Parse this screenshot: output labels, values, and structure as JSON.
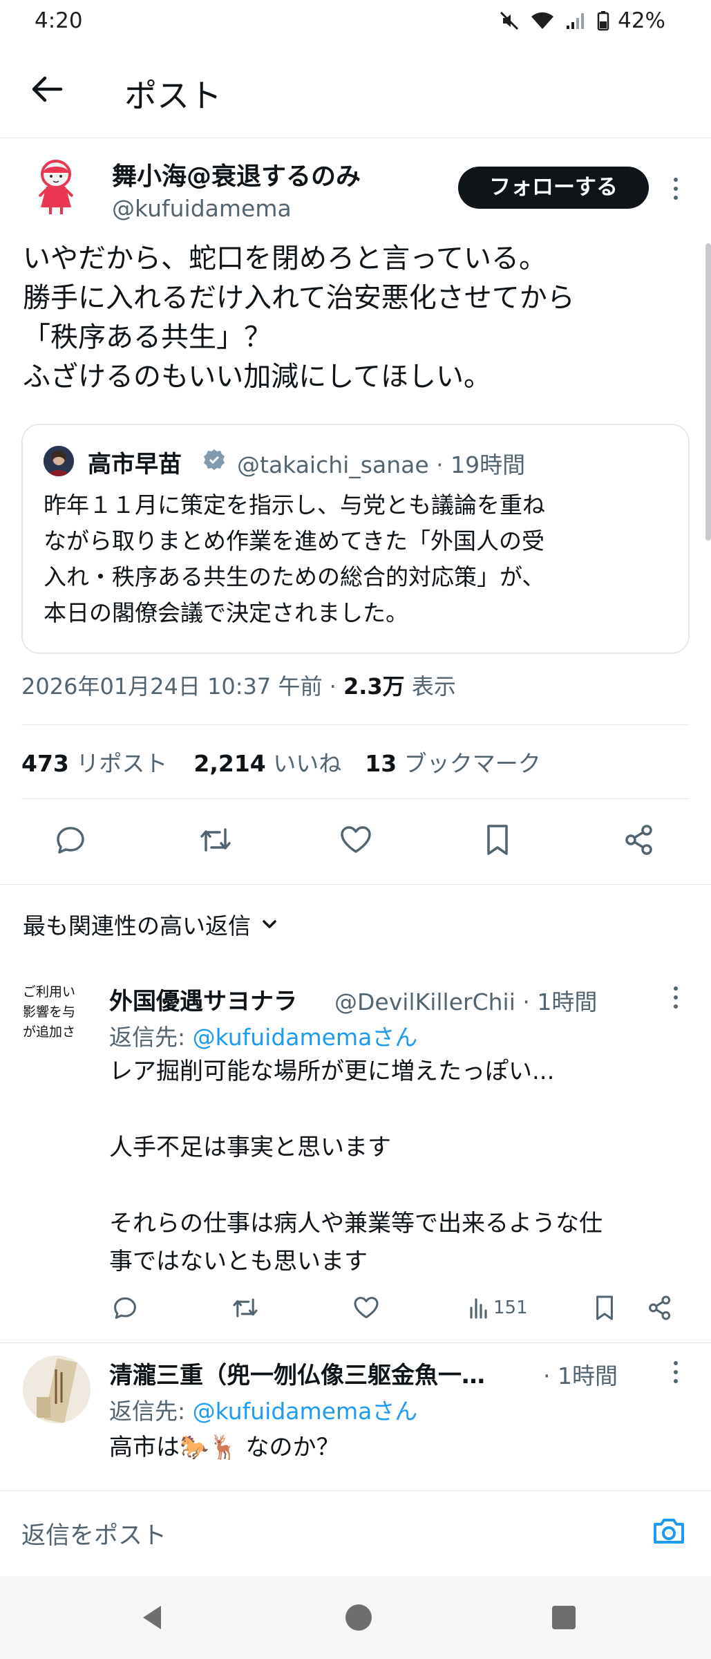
{
  "status_bar": {
    "time": "4:20",
    "battery": "42%"
  },
  "header": {
    "title": "ポスト"
  },
  "post": {
    "author_name": "舞小海@衰退するのみ",
    "author_handle": "@kufuidamema",
    "follow_label": "フォローする",
    "text": "いやだから、蛇口を閉めろと言っている。\n勝手に入れるだけ入れて治安悪化させてから\n「秩序ある共生」？\nふざけるのもいい加減にしてほしい。",
    "quote": {
      "author_name": "高市早苗",
      "author_handle_time": "@takaichi_sanae · 19時間",
      "text": "昨年１１月に策定を指示し、与党とも議論を重ね\nながら取りまとめ作業を進めてきた「外国人の受\n入れ・秩序ある共生のための総合的対応策」が、\n本日の閣僚会議で決定されました。"
    },
    "meta_datetime": "2026年01月24日 10:37 午前 · ",
    "meta_views": "2.3万",
    "meta_views_label": " 表示",
    "stats": {
      "reposts_count": "473",
      "reposts_label": " リポスト",
      "likes_count": "2,214",
      "likes_label": " いいね",
      "bookmarks_count": "13",
      "bookmarks_label": " ブックマーク"
    }
  },
  "sort_label": "最も関連性の高い返信",
  "replies": [
    {
      "avatar_text": "ご利用い\n影響を与\nが追加さ",
      "author_name": "外国優遇サヨナラ",
      "author_handle_time": "@DevilKillerChii · 1時間",
      "reply_to_prefix": "返信先: ",
      "reply_to_handle": "@kufuidamemaさん",
      "text": "レア掘削可能な場所が更に増えたっぽい...\n\n人手不足は事実と思います\n\nそれらの仕事は病人や兼業等で出来るような仕\n事ではないとも思います",
      "views": "151"
    },
    {
      "author_name": "清瀧三重（兜一刎仏像三躯金魚一…",
      "author_handle_time": "· 1時間",
      "reply_to_prefix": "返信先: ",
      "reply_to_handle": "@kufuidamemaさん",
      "text": "高市は🐎🦌 なのか？"
    }
  ],
  "composer": {
    "placeholder": "返信をポスト"
  },
  "colors": {
    "accent": "#1d9bf0",
    "text": "#0f1419",
    "secondary": "#536471"
  }
}
